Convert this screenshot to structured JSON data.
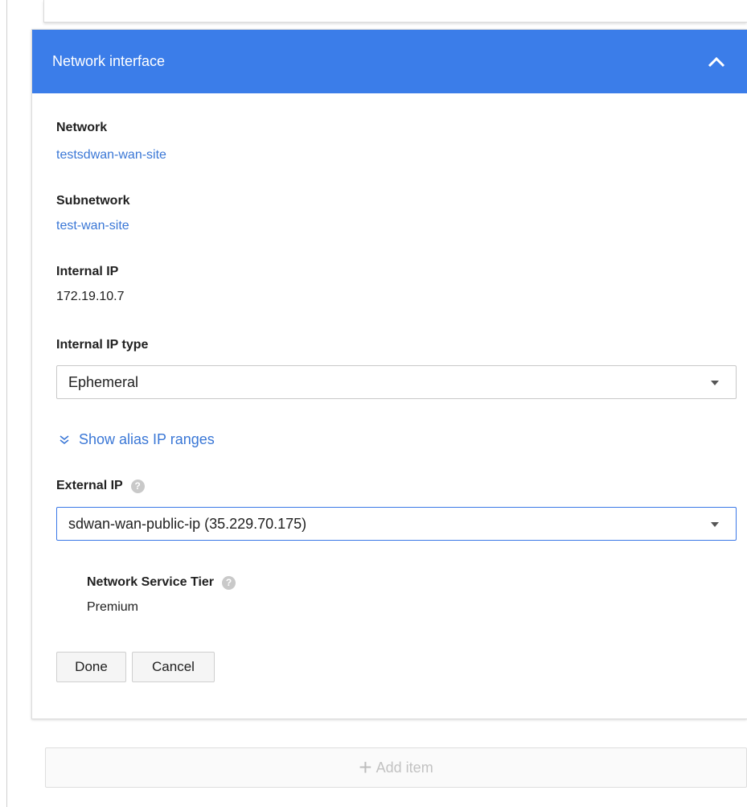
{
  "panel": {
    "title": "Network interface",
    "network": {
      "label": "Network",
      "value": "testsdwan-wan-site"
    },
    "subnetwork": {
      "label": "Subnetwork",
      "value": "test-wan-site"
    },
    "internal_ip": {
      "label": "Internal IP",
      "value": "172.19.10.7"
    },
    "internal_ip_type": {
      "label": "Internal IP type",
      "selected": "Ephemeral"
    },
    "alias_toggle": "Show alias IP ranges",
    "external_ip": {
      "label": "External IP",
      "selected": "sdwan-wan-public-ip (35.229.70.175)"
    },
    "service_tier": {
      "label": "Network Service Tier",
      "value": "Premium"
    },
    "buttons": {
      "done": "Done",
      "cancel": "Cancel"
    }
  },
  "add_item": {
    "label": "Add item"
  },
  "colors": {
    "header": "#3b7de9",
    "link": "#3a77d6"
  },
  "icons": {
    "collapse": "chevron-up-icon",
    "alias": "double-chevron-down-icon",
    "help": "help-icon",
    "add": "plus-icon"
  }
}
